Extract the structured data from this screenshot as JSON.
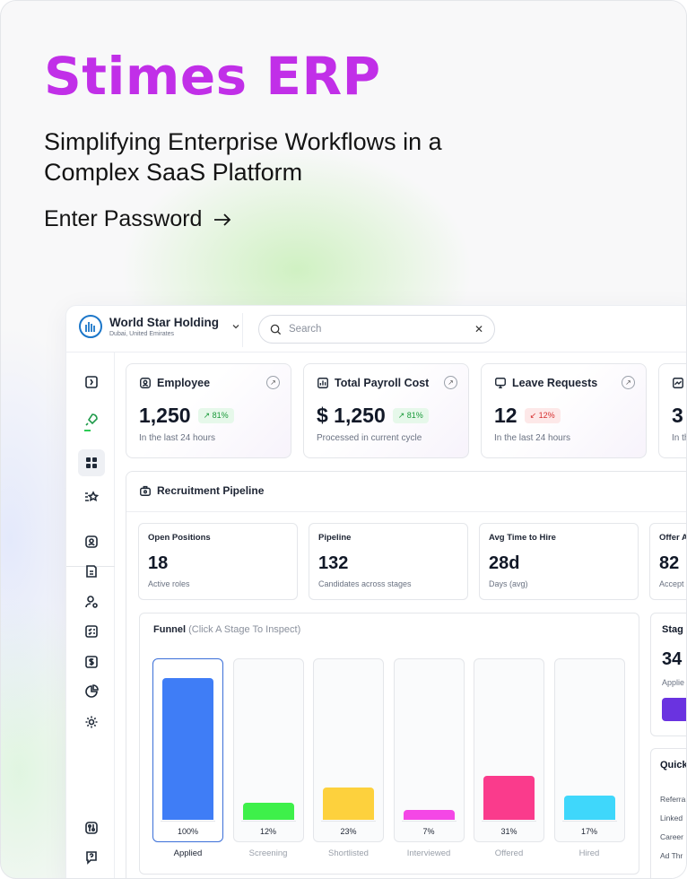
{
  "hero": {
    "brand": "Stimes ERP",
    "tagline": "Simplifying Enterprise Workflows in a Complex SaaS Platform",
    "cta": "Enter Password"
  },
  "app": {
    "org": {
      "name": "World Star Holding",
      "location": "Dubai, United Emirates"
    },
    "search": {
      "placeholder": "Search"
    },
    "kpis": [
      {
        "title": "Employee",
        "value": "1,250",
        "badge": "81%",
        "trend": "up",
        "sub": "In the last 24 hours",
        "icon": "user-card-icon"
      },
      {
        "title": "Total Payroll Cost",
        "value": "$ 1,250",
        "badge": "81%",
        "trend": "up",
        "sub": "Processed in current cycle",
        "icon": "bar-chart-icon"
      },
      {
        "title": "Leave Requests",
        "value": "12",
        "badge": "12%",
        "trend": "down",
        "sub": "In the last 24 hours",
        "icon": "monitor-icon"
      },
      {
        "title": "",
        "value": "3",
        "badge": "",
        "trend": "",
        "sub": "In th",
        "icon": "trend-icon"
      }
    ],
    "pipeline": {
      "title": "Recruitment Pipeline",
      "stats": [
        {
          "title": "Open Positions",
          "value": "18",
          "sub": "Active roles"
        },
        {
          "title": "Pipeline",
          "value": "132",
          "sub": "Candidates across stages"
        },
        {
          "title": "Avg Time to Hire",
          "value": "28d",
          "sub": "Days (avg)"
        },
        {
          "title": "Offer A",
          "value": "82",
          "sub": "Accept"
        }
      ],
      "funnel": {
        "title": "Funnel",
        "hint": "(Click A Stage To Inspect)",
        "stages": [
          {
            "label": "Applied",
            "percent": 100,
            "pct_text": "100%",
            "color": "#3f7df6",
            "selected": true
          },
          {
            "label": "Screening",
            "percent": 12,
            "pct_text": "12%",
            "color": "#3ef04a",
            "selected": false
          },
          {
            "label": "Shortlisted",
            "percent": 23,
            "pct_text": "23%",
            "color": "#fdd13d",
            "selected": false
          },
          {
            "label": "Interviewed",
            "percent": 7,
            "pct_text": "7%",
            "color": "#f447e6",
            "selected": false
          },
          {
            "label": "Offered",
            "percent": 31,
            "pct_text": "31%",
            "color": "#fa3b8c",
            "selected": false
          },
          {
            "label": "Hired",
            "percent": 17,
            "pct_text": "17%",
            "color": "#3fd7fb",
            "selected": false
          }
        ]
      },
      "stage_card": {
        "title": "Stag",
        "value": "34",
        "sub": "Applie"
      },
      "quick_card": {
        "title": "Quick",
        "items": [
          "Referra",
          "Linked",
          "Career",
          "Ad Thr"
        ]
      }
    }
  }
}
